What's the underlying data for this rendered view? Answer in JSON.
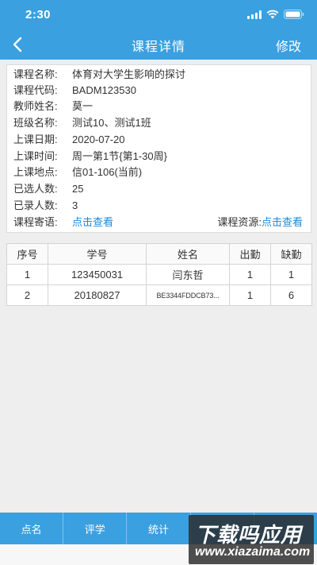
{
  "status": {
    "time": "2:30"
  },
  "nav": {
    "title": "课程详情",
    "edit": "修改"
  },
  "course": {
    "rows": [
      {
        "label": "课程名称:",
        "value": "体育对大学生影响的探讨"
      },
      {
        "label": "课程代码:",
        "value": " BADM123530"
      },
      {
        "label": "教师姓名:",
        "value": "莫一"
      },
      {
        "label": "班级名称:",
        "value": "测试10、测试1班"
      },
      {
        "label": "上课日期:",
        "value": "2020-07-20"
      },
      {
        "label": "上课时间:",
        "value": "周一第1节{第1-30周}"
      },
      {
        "label": "上课地点:",
        "value": "信01-106(当前)"
      },
      {
        "label": "已选人数:",
        "value": "25"
      },
      {
        "label": "已录人数:",
        "value": "3"
      }
    ],
    "message_label": "课程寄语:",
    "message_link": "点击查看",
    "resource_label": "课程资源:",
    "resource_link": "点击查看"
  },
  "table": {
    "headers": [
      "序号",
      "学号",
      "姓名",
      "出勤",
      "缺勤"
    ],
    "rows": [
      [
        "1",
        "123450031",
        "闫东哲",
        "1",
        "1"
      ],
      [
        "2",
        "20180827",
        "BE3344FDDCB73...",
        "1",
        "6"
      ]
    ]
  },
  "tabs": [
    "点名",
    "评学",
    "统计",
    "",
    ""
  ],
  "watermark": {
    "title": "下载吗应用",
    "url": "www.xiazaima.com"
  },
  "colors": {
    "primary": "#3aa0e0",
    "link": "#1e88d8"
  }
}
